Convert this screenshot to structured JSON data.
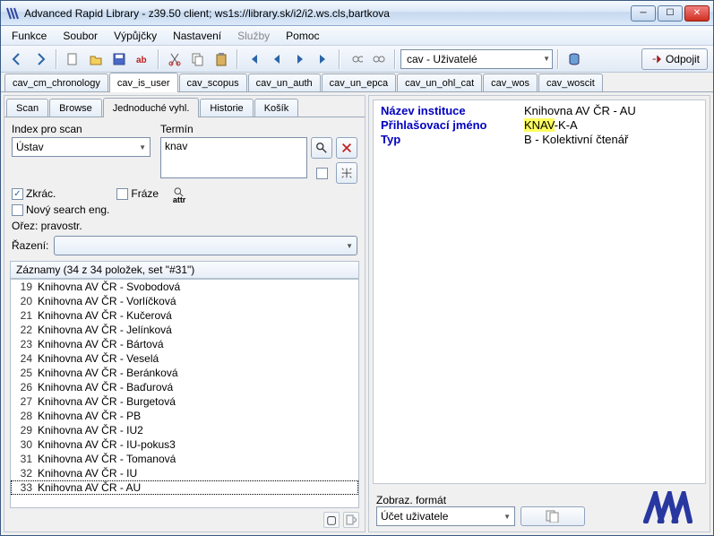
{
  "app": {
    "title": "Advanced Rapid Library - z39.50 client; ws1s://library.sk/i2/i2.ws.cls,bartkova"
  },
  "menu": {
    "funkce": "Funkce",
    "soubor": "Soubor",
    "vypujcky": "Výpůjčky",
    "nastaveni": "Nastavení",
    "sluzby": "Služby",
    "pomoc": "Pomoc"
  },
  "toolbar": {
    "server_combo": "cav - Uživatelé",
    "odpojit": "Odpojit"
  },
  "tabs": [
    "cav_cm_chronology",
    "cav_is_user",
    "cav_scopus",
    "cav_un_auth",
    "cav_un_epca",
    "cav_un_ohl_cat",
    "cav_wos",
    "cav_woscit"
  ],
  "innertabs": [
    "Scan",
    "Browse",
    "Jednoduché vyhl.",
    "Historie",
    "Košík"
  ],
  "scan": {
    "index_lbl": "Index pro scan",
    "termin_lbl": "Termín",
    "index_val": "Ústav",
    "termin_val": "knav",
    "zkrac": "Zkrác.",
    "fraze": "Fráze",
    "novysearch": "Nový search eng.",
    "attr": "attr",
    "orez": "Ořez: pravostr.",
    "razeni": "Řazení:"
  },
  "records": {
    "header": "Záznamy (34 z 34 položek, set \"#31\")",
    "rows": [
      {
        "n": "19",
        "t": "Knihovna AV ČR - Svobodová"
      },
      {
        "n": "20",
        "t": "Knihovna AV ČR - Vorlíčková"
      },
      {
        "n": "21",
        "t": "Knihovna AV ČR - Kučerová"
      },
      {
        "n": "22",
        "t": "Knihovna AV ČR - Jelínková"
      },
      {
        "n": "23",
        "t": "Knihovna AV ČR - Bártová"
      },
      {
        "n": "24",
        "t": "Knihovna AV ČR - Veselá"
      },
      {
        "n": "25",
        "t": "Knihovna AV ČR - Beránková"
      },
      {
        "n": "26",
        "t": "Knihovna AV ČR - Baďurová"
      },
      {
        "n": "27",
        "t": "Knihovna AV ČR - Burgetová"
      },
      {
        "n": "28",
        "t": "Knihovna AV ČR - PB"
      },
      {
        "n": "29",
        "t": "Knihovna AV ČR - IU2"
      },
      {
        "n": "30",
        "t": "Knihovna AV ČR - IU-pokus3"
      },
      {
        "n": "31",
        "t": "Knihovna AV ČR - Tomanová"
      },
      {
        "n": "32",
        "t": "Knihovna AV ČR - IU"
      },
      {
        "n": "33",
        "t": "Knihovna AV ČR - AU"
      }
    ],
    "selected_index": 14
  },
  "detail": {
    "f1": {
      "name": "Název instituce",
      "val": "Knihovna AV ČR - AU"
    },
    "f2": {
      "name": "Přihlašovací jméno",
      "hl": "KNAV",
      "rest": "-K-A"
    },
    "f3": {
      "name": "Typ",
      "val": "B - Kolektivní čtenář"
    }
  },
  "rbottom": {
    "lbl": "Zobraz. formát",
    "combo": "Účet uživatele"
  }
}
